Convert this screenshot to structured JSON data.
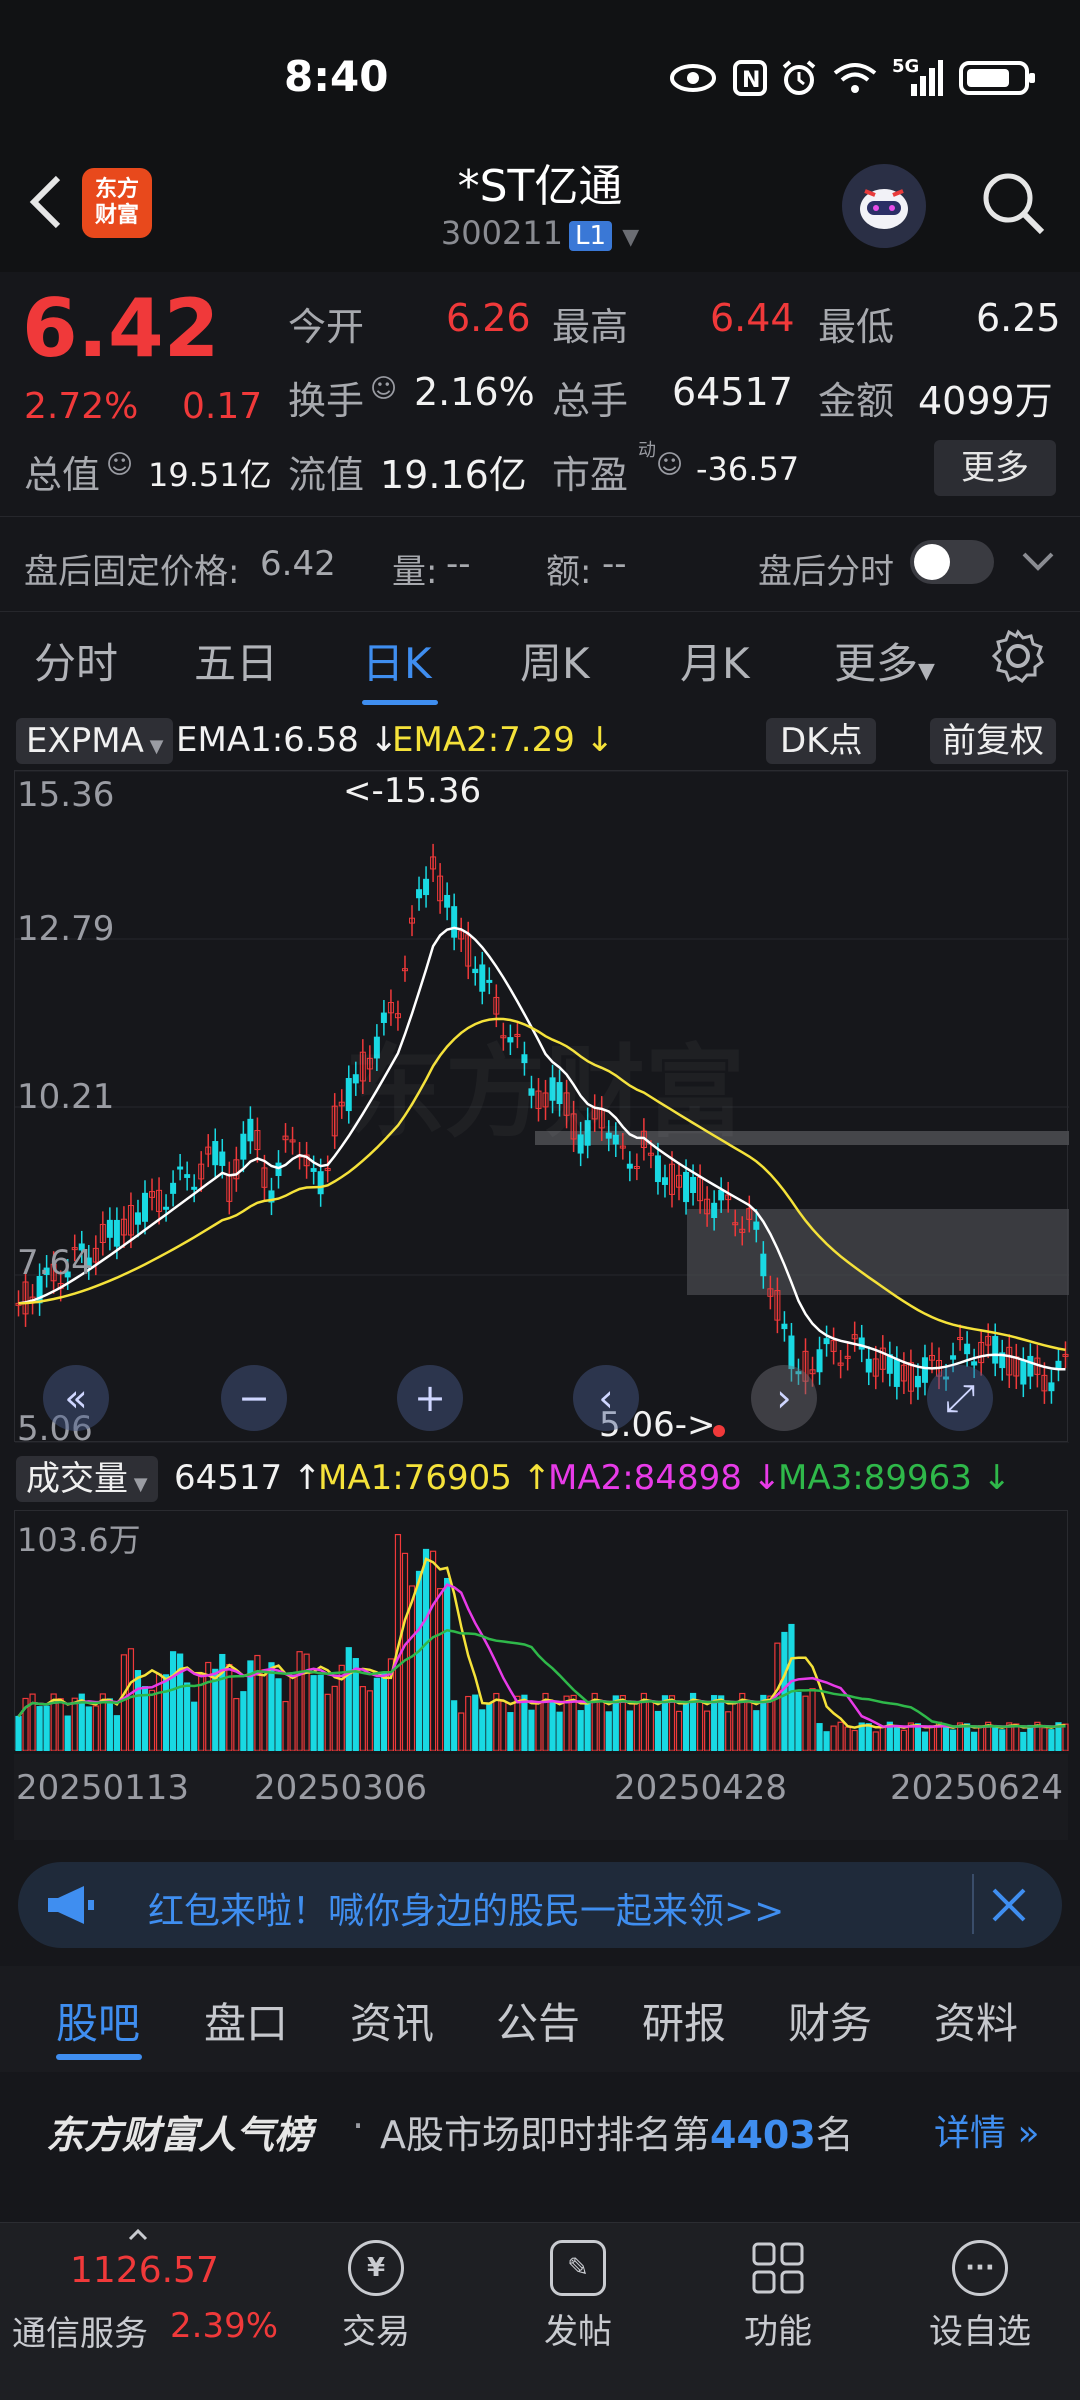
{
  "status_bar": {
    "time": "8:40",
    "network": "5G"
  },
  "header": {
    "title": "*ST亿通",
    "code": "300211",
    "level_badge": "L1",
    "logo_line1": "东方",
    "logo_line2": "财富"
  },
  "quote": {
    "price": "6.42",
    "change_pct": "2.72%",
    "change": "0.17",
    "open_label": "今开",
    "open": "6.26",
    "high_label": "最高",
    "high": "6.44",
    "low_label": "最低",
    "low": "6.25",
    "turnover_label": "换手",
    "turnover": "2.16%",
    "volume_label": "总手",
    "volume": "64517",
    "amount_label": "金额",
    "amount": "4099万",
    "mcap_label": "总值",
    "mcap": "19.51亿",
    "float_label": "流值",
    "float_cap": "19.16亿",
    "pe_label": "市盈",
    "pe_sup": "动",
    "pe": "-36.57",
    "more": "更多"
  },
  "after_hours": {
    "price_label": "盘后固定价格:",
    "price": "6.42",
    "vol_label": "量:",
    "vol": "--",
    "amt_label": "额:",
    "amt": "--",
    "intraday_label": "盘后分时"
  },
  "period_tabs": [
    "分时",
    "五日",
    "日K",
    "周K",
    "月K",
    "更多"
  ],
  "indicator": {
    "name": "EXPMA",
    "ema1": "EMA1:6.58",
    "ema2": "EMA2:7.29",
    "dk": "DK点",
    "adjust": "前复权",
    "y_labels": [
      "15.36",
      "12.79",
      "10.21",
      "7.64",
      "5.06"
    ],
    "max_marker": "<-15.36",
    "min_marker": "5.06->"
  },
  "volume_bar": {
    "name": "成交量",
    "vol": "64517",
    "ma1": "MA1:76905",
    "ma2": "MA2:84898",
    "ma3": "MA3:89963",
    "max_label": "103.6万",
    "dates": [
      "20250113",
      "20250306",
      "20250428",
      "20250624"
    ]
  },
  "banner": {
    "text": "红包来啦！喊你身边的股民一起来领>>"
  },
  "section_tabs": [
    "股吧",
    "盘口",
    "资讯",
    "公告",
    "研报",
    "财务",
    "资料"
  ],
  "rank": {
    "brand": "东方财富人气榜",
    "dot": "·",
    "text_before": "A股市场即时排名第",
    "rank": "4403",
    "text_after": "名",
    "details": "详情"
  },
  "bottom_nav": {
    "index_value": "1126.57",
    "index_name": "通信服务",
    "index_pct": "2.39%",
    "items": [
      "交易",
      "发帖",
      "功能",
      "设自选"
    ]
  },
  "colors": {
    "up": "#f0393a",
    "down": "#19d9e3",
    "accent": "#3f8ef0",
    "ema2": "#f5e23a",
    "ma2": "#e83be8",
    "ma3": "#2fb84a"
  }
}
